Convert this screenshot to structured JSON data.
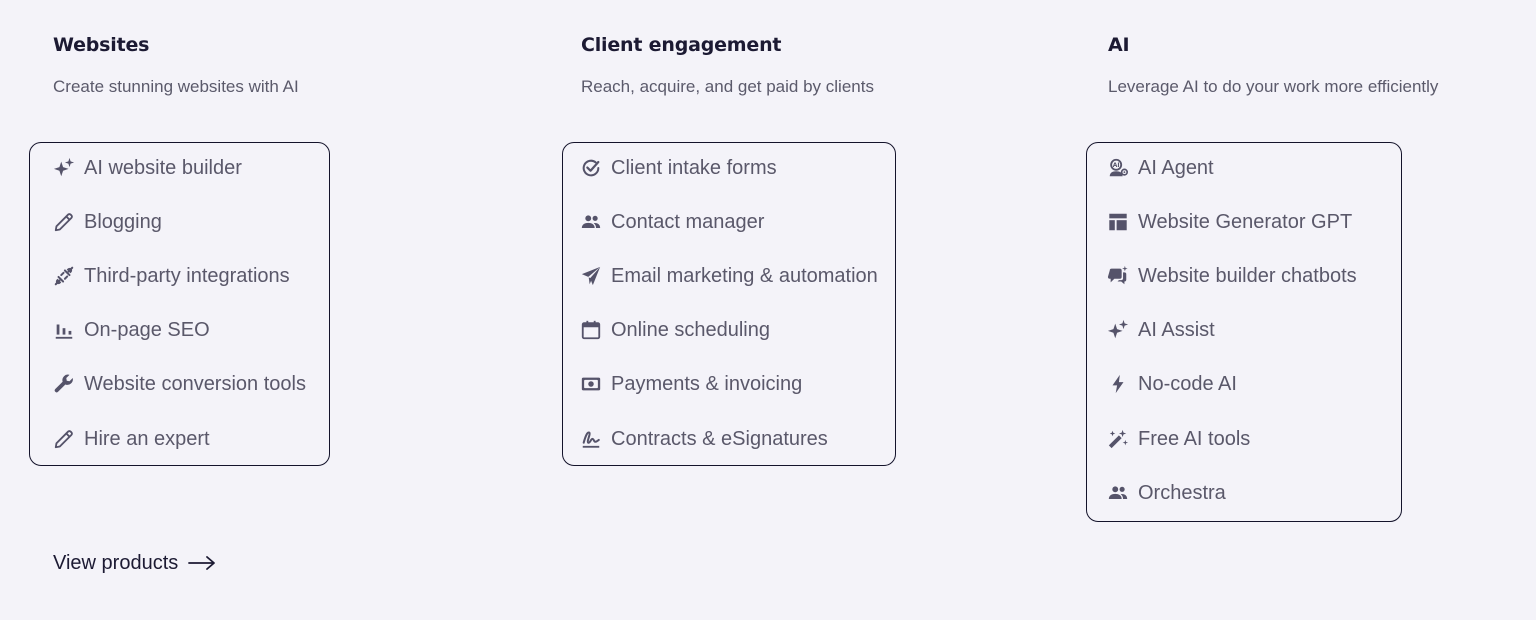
{
  "colors": {
    "background": "#f4f3f9",
    "title": "#1c1a33",
    "text": "#5a586a",
    "icon": "#55536a",
    "border": "#14132b"
  },
  "columns": [
    {
      "title": "Websites",
      "description": "Create stunning websites with AI",
      "items": [
        {
          "label": "AI website builder",
          "icon": "sparkle-icon"
        },
        {
          "label": "Blogging",
          "icon": "pencil-icon"
        },
        {
          "label": "Third-party integrations",
          "icon": "plug-icon"
        },
        {
          "label": "On-page SEO",
          "icon": "bar-chart-icon"
        },
        {
          "label": "Website conversion tools",
          "icon": "wrench-icon"
        },
        {
          "label": "Hire an expert",
          "icon": "pencil-icon"
        }
      ]
    },
    {
      "title": "Client engagement",
      "description": "Reach, acquire, and get paid by clients",
      "items": [
        {
          "label": "Client intake forms",
          "icon": "check-circle-icon"
        },
        {
          "label": "Contact manager",
          "icon": "people-icon"
        },
        {
          "label": "Email marketing & automation",
          "icon": "send-icon"
        },
        {
          "label": "Online scheduling",
          "icon": "calendar-icon"
        },
        {
          "label": "Payments & invoicing",
          "icon": "payment-icon"
        },
        {
          "label": "Contracts & eSignatures",
          "icon": "signature-icon"
        }
      ]
    },
    {
      "title": "AI",
      "description": "Leverage AI to do your work more efficiently",
      "items": [
        {
          "label": "AI Agent",
          "icon": "ai-agent-icon"
        },
        {
          "label": "Website Generator GPT",
          "icon": "layout-icon"
        },
        {
          "label": "Website builder chatbots",
          "icon": "chat-icon"
        },
        {
          "label": "AI Assist",
          "icon": "sparkle-icon"
        },
        {
          "label": "No-code AI",
          "icon": "bolt-icon"
        },
        {
          "label": "Free AI tools",
          "icon": "magic-wand-icon"
        },
        {
          "label": "Orchestra",
          "icon": "people-icon"
        }
      ]
    }
  ],
  "footer": {
    "view_products_label": "View products"
  }
}
